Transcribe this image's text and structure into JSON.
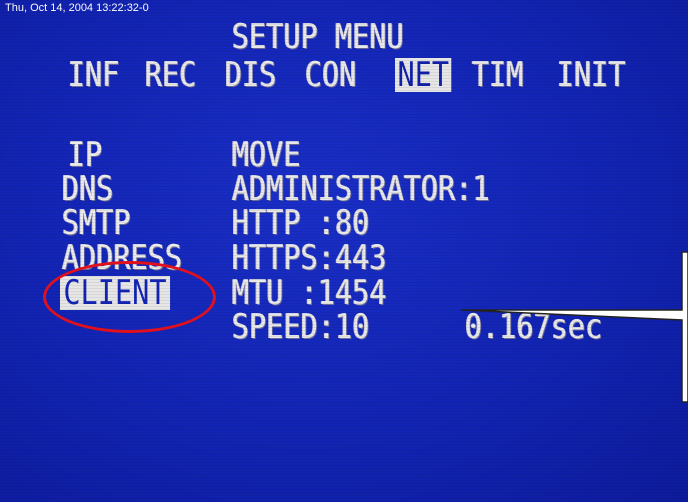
{
  "timestamp": "Thu, Oct 14, 2004 13:22:32-0",
  "title": "SETUP MENU",
  "tabs": [
    {
      "label": "INF",
      "selected": false
    },
    {
      "label": "REC",
      "selected": false
    },
    {
      "label": "DIS",
      "selected": false
    },
    {
      "label": "CON",
      "selected": false
    },
    {
      "label": "NET",
      "selected": true
    },
    {
      "label": "TIM",
      "selected": false
    },
    {
      "label": "INIT",
      "selected": false
    }
  ],
  "left_items": [
    {
      "label": "IP",
      "selected": false
    },
    {
      "label": "DNS",
      "selected": false
    },
    {
      "label": "SMTP",
      "selected": false
    },
    {
      "label": "ADDRESS",
      "selected": false
    },
    {
      "label": "CLIENT",
      "selected": true
    }
  ],
  "right_values": {
    "move": "MOVE",
    "administrator": "ADMINISTRATOR:1",
    "http": "HTTP :80",
    "https": "HTTPS:443",
    "mtu": "MTU  :1454",
    "speed": "SPEED:10",
    "speed_time": "0.167sec"
  },
  "colors": {
    "background": "#1224b4",
    "osd_text": "#e9e9e9",
    "highlight_circle": "#e0101c",
    "callout_fill": "#ffffff"
  }
}
